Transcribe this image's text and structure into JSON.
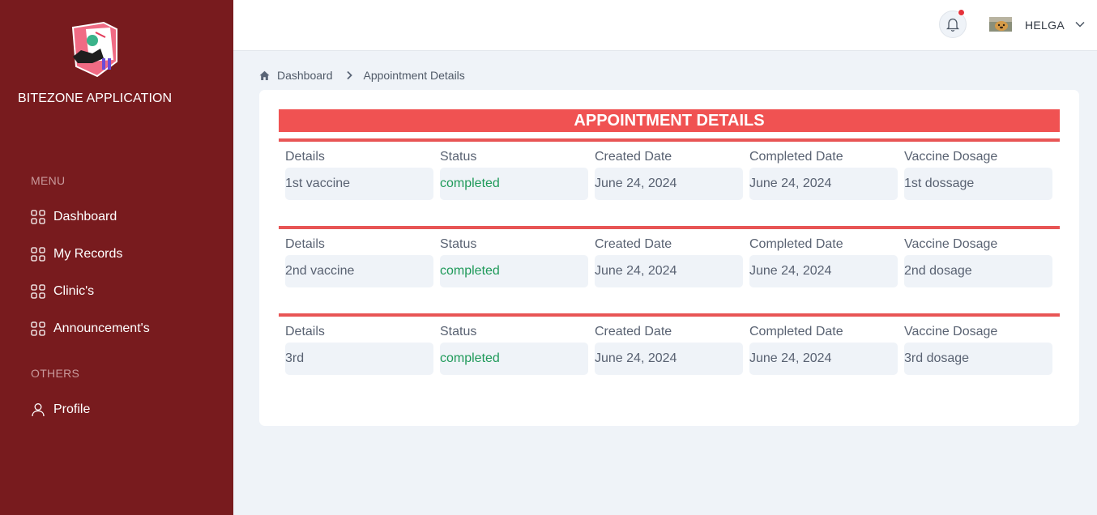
{
  "app": {
    "name": "BITEZONE APPLICATION"
  },
  "sidebar": {
    "menu_label": "MENU",
    "items": [
      {
        "label": "Dashboard",
        "icon": "grid-icon"
      },
      {
        "label": "My Records",
        "icon": "grid-icon"
      },
      {
        "label": "Clinic's",
        "icon": "grid-icon"
      },
      {
        "label": "Announcement's",
        "icon": "grid-icon"
      }
    ],
    "others_label": "OTHERS",
    "others_items": [
      {
        "label": "Profile",
        "icon": "user-icon"
      }
    ]
  },
  "header": {
    "username": "HELGA",
    "has_notification": true
  },
  "breadcrumb": {
    "items": [
      "Dashboard",
      "Appointment Details"
    ]
  },
  "main": {
    "title": "APPOINTMENT DETAILS",
    "columns": [
      "Details",
      "Status",
      "Created Date",
      "Completed Date",
      "Vaccine Dosage"
    ],
    "records": [
      {
        "details": "1st vaccine",
        "status": "completed",
        "created": "June 24, 2024",
        "completed": "June 24, 2024",
        "dosage": "1st dossage"
      },
      {
        "details": "2nd vaccine",
        "status": "completed",
        "created": "June 24, 2024",
        "completed": "June 24, 2024",
        "dosage": "2nd dosage"
      },
      {
        "details": "3rd",
        "status": "completed",
        "created": "June 24, 2024",
        "completed": "June 24, 2024",
        "dosage": "3rd dosage"
      }
    ]
  },
  "colors": {
    "sidebar_bg": "#781b1e",
    "accent_red": "#f05252",
    "status_green": "#1f9a5a",
    "page_bg": "#eff3f8"
  }
}
